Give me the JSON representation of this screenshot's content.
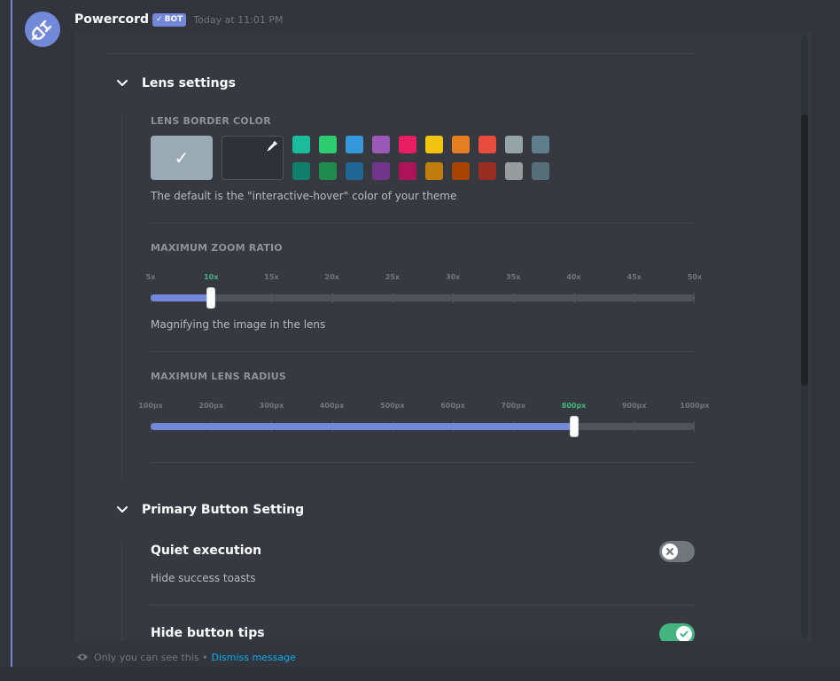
{
  "message": {
    "author": "Powercord",
    "badge": "BOT",
    "timestamp": "Today at 11:01 PM",
    "avatar_icon": "plug-icon"
  },
  "lens_section": {
    "title": "Lens settings",
    "border_color": {
      "label": "LENS BORDER COLOR",
      "default_color": "#99aab5",
      "selected": "default",
      "swatches_row1": [
        "#1abc9c",
        "#2ecc71",
        "#3498db",
        "#9b59b6",
        "#e91e63",
        "#f1c40f",
        "#e67e22",
        "#e74c3c",
        "#95a5a6",
        "#607d8b"
      ],
      "swatches_row2": [
        "#11806a",
        "#1f8b4c",
        "#206694",
        "#71368a",
        "#ad1457",
        "#c27c0e",
        "#a84300",
        "#992d22",
        "#979c9f",
        "#546e7a"
      ],
      "description": "The default is the \"interactive-hover\" color of your theme"
    },
    "zoom_ratio": {
      "label": "MAXIMUM ZOOM RATIO",
      "ticks": [
        "5x",
        "10x",
        "15x",
        "20x",
        "25x",
        "30x",
        "35x",
        "40x",
        "45x",
        "50x"
      ],
      "selected_index": 1,
      "value": "10x",
      "description": "Magnifying the image in the lens"
    },
    "lens_radius": {
      "label": "MAXIMUM LENS RADIUS",
      "ticks": [
        "100px",
        "200px",
        "300px",
        "400px",
        "500px",
        "600px",
        "700px",
        "800px",
        "900px",
        "1000px"
      ],
      "selected_index": 7,
      "value": "800px"
    }
  },
  "primary_section": {
    "title": "Primary Button Setting",
    "quiet_execution": {
      "title": "Quiet execution",
      "description": "Hide success toasts",
      "enabled": false
    },
    "hide_button_tips": {
      "title": "Hide button tips",
      "enabled": true
    }
  },
  "footer": {
    "notice": "Only you can see this •",
    "dismiss": "Dismiss message"
  },
  "colors": {
    "accent": "#7289da",
    "toggle_on": "#43b581",
    "toggle_off": "#72767d"
  }
}
